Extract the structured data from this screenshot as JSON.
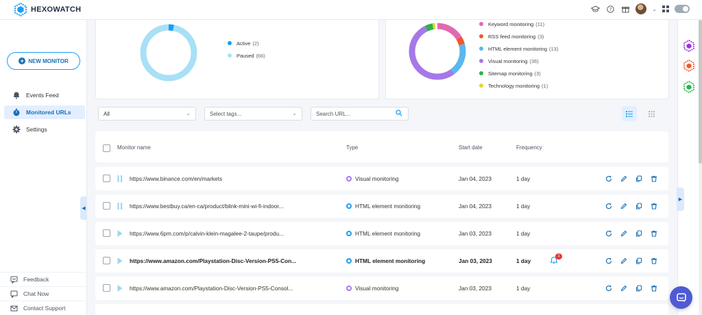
{
  "app": {
    "name": "HEXOWATCH",
    "brand_color": "#1a9df3"
  },
  "sidebar": {
    "new_monitor_label": "NEW MONITOR",
    "items": [
      {
        "label": "Events Feed",
        "icon": "bell-icon"
      },
      {
        "label": "Monitored URLs",
        "icon": "stopwatch-icon",
        "active": true
      },
      {
        "label": "Settings",
        "icon": "gear-icon"
      }
    ],
    "bottom_links": [
      {
        "label": "Feedback",
        "icon": "feedback-icon"
      },
      {
        "label": "Chat Now",
        "icon": "chat-icon"
      },
      {
        "label": "Contact Support",
        "icon": "mail-icon"
      }
    ]
  },
  "status_chart": {
    "legend": [
      {
        "label": "Active",
        "count": "(2)",
        "color": "#1a9df3"
      },
      {
        "label": "Paused",
        "count": "(66)",
        "color": "#a8e0f5"
      }
    ]
  },
  "type_chart": {
    "legend": [
      {
        "label": "Keyword monitoring",
        "count": "(11)",
        "color": "#e06ab0"
      },
      {
        "label": "RSS feed monitoring",
        "count": "(3)",
        "color": "#f0582a"
      },
      {
        "label": "HTML element monitoring",
        "count": "(13)",
        "color": "#5ab8ee"
      },
      {
        "label": "Visual monitoring",
        "count": "(36)",
        "color": "#a678e8"
      },
      {
        "label": "Sitemap monitoring",
        "count": "(3)",
        "color": "#2bb24c"
      },
      {
        "label": "Technology monitoring",
        "count": "(1)",
        "color": "#e6d53a"
      }
    ]
  },
  "filters": {
    "status_select": "All",
    "tags_placeholder": "Select tags...",
    "search_placeholder": "Search URL..."
  },
  "table": {
    "headers": {
      "name": "Monitor name",
      "type": "Type",
      "start": "Start date",
      "frequency": "Frequency"
    },
    "rows": [
      {
        "url": "https://www.binance.com/en/markets",
        "type": "Visual monitoring",
        "type_color": "#a678e8",
        "date": "Jan 04, 2023",
        "freq": "1 day",
        "status": "paused",
        "bold": false
      },
      {
        "url": "https://www.bestbuy.ca/en-ca/product/blink-mini-wi-fi-indoor...",
        "type": "HTML element monitoring",
        "type_color": "#1a9df3",
        "date": "Jan 04, 2023",
        "freq": "1 day",
        "status": "paused",
        "bold": false
      },
      {
        "url": "https://www.6pm.com/p/calvin-klein-magalee-2-taupe/produ...",
        "type": "HTML element monitoring",
        "type_color": "#1a9df3",
        "date": "Jan 03, 2023",
        "freq": "1 day",
        "status": "play",
        "bold": false
      },
      {
        "url": "https://www.amazon.com/Playstation-Disc-Version-PS5-Con...",
        "type": "HTML element monitoring",
        "type_color": "#1a9df3",
        "date": "Jan 03, 2023",
        "freq": "1 day",
        "status": "play",
        "bold": true,
        "notification": "1"
      },
      {
        "url": "https://www.amazon.com/Playstation-Disc-Version-PS5-Consol...",
        "type": "Visual monitoring",
        "type_color": "#a678e8",
        "date": "Jan 03, 2023",
        "freq": "1 day",
        "status": "play",
        "bold": false
      }
    ]
  }
}
